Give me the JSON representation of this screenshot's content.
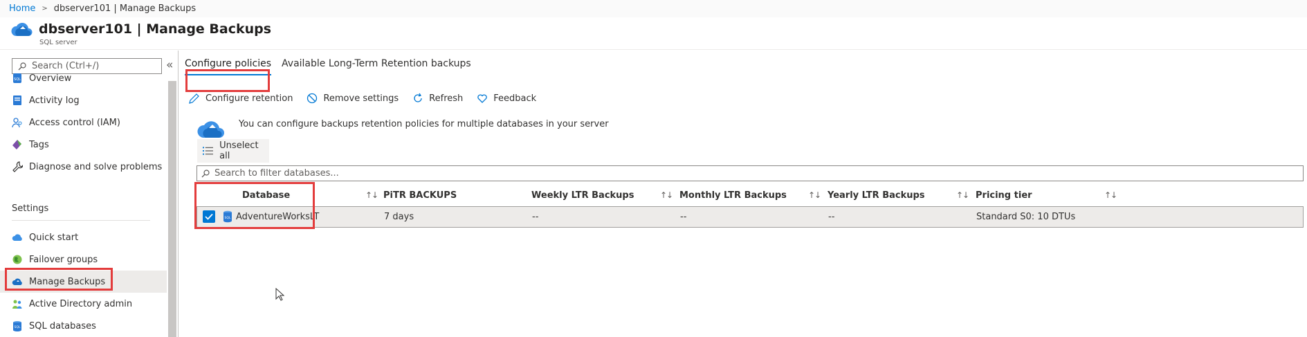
{
  "breadcrumb": {
    "home": "Home",
    "separator": ">",
    "current": "dbserver101 | Manage Backups"
  },
  "header": {
    "title": "dbserver101 | Manage Backups",
    "subtitle": "SQL server"
  },
  "sidebar": {
    "search_placeholder": "Search (Ctrl+/)",
    "collapse": "«",
    "items_top": [
      {
        "label": "Overview",
        "icon": "sql-server-icon"
      },
      {
        "label": "Activity log",
        "icon": "activity-log-icon"
      },
      {
        "label": "Access control (IAM)",
        "icon": "iam-icon"
      },
      {
        "label": "Tags",
        "icon": "tag-icon"
      },
      {
        "label": "Diagnose and solve problems",
        "icon": "wrench-icon"
      }
    ],
    "section_settings": "Settings",
    "items_settings": [
      {
        "label": "Quick start",
        "icon": "cloud-icon"
      },
      {
        "label": "Failover groups",
        "icon": "globe-icon"
      },
      {
        "label": "Manage Backups",
        "icon": "backup-cloud-icon"
      },
      {
        "label": "Active Directory admin",
        "icon": "users-icon"
      },
      {
        "label": "SQL databases",
        "icon": "sql-db-icon"
      }
    ]
  },
  "tabs": [
    "Configure policies",
    "Available Long-Term Retention backups"
  ],
  "toolbar": {
    "configure_retention": "Configure retention",
    "remove_settings": "Remove settings",
    "refresh": "Refresh",
    "feedback": "Feedback"
  },
  "info_text": "You can configure backups retention policies for multiple databases in your server",
  "unselect_all": "Unselect all",
  "filter_placeholder": "Search to filter databases...",
  "table": {
    "columns": [
      "Database",
      "PiTR BACKUPS",
      "Weekly LTR Backups",
      "Monthly LTR Backups",
      "Yearly LTR Backups",
      "Pricing tier"
    ],
    "sort_glyph": "↑↓",
    "rows": [
      {
        "database": "AdventureWorksLT",
        "pitr": "7 days",
        "weekly": "--",
        "monthly": "--",
        "yearly": "--",
        "pricing": "Standard S0: 10 DTUs",
        "selected": true
      }
    ]
  },
  "colors": {
    "accent": "#0078d4",
    "highlight": "#e33c3c"
  }
}
